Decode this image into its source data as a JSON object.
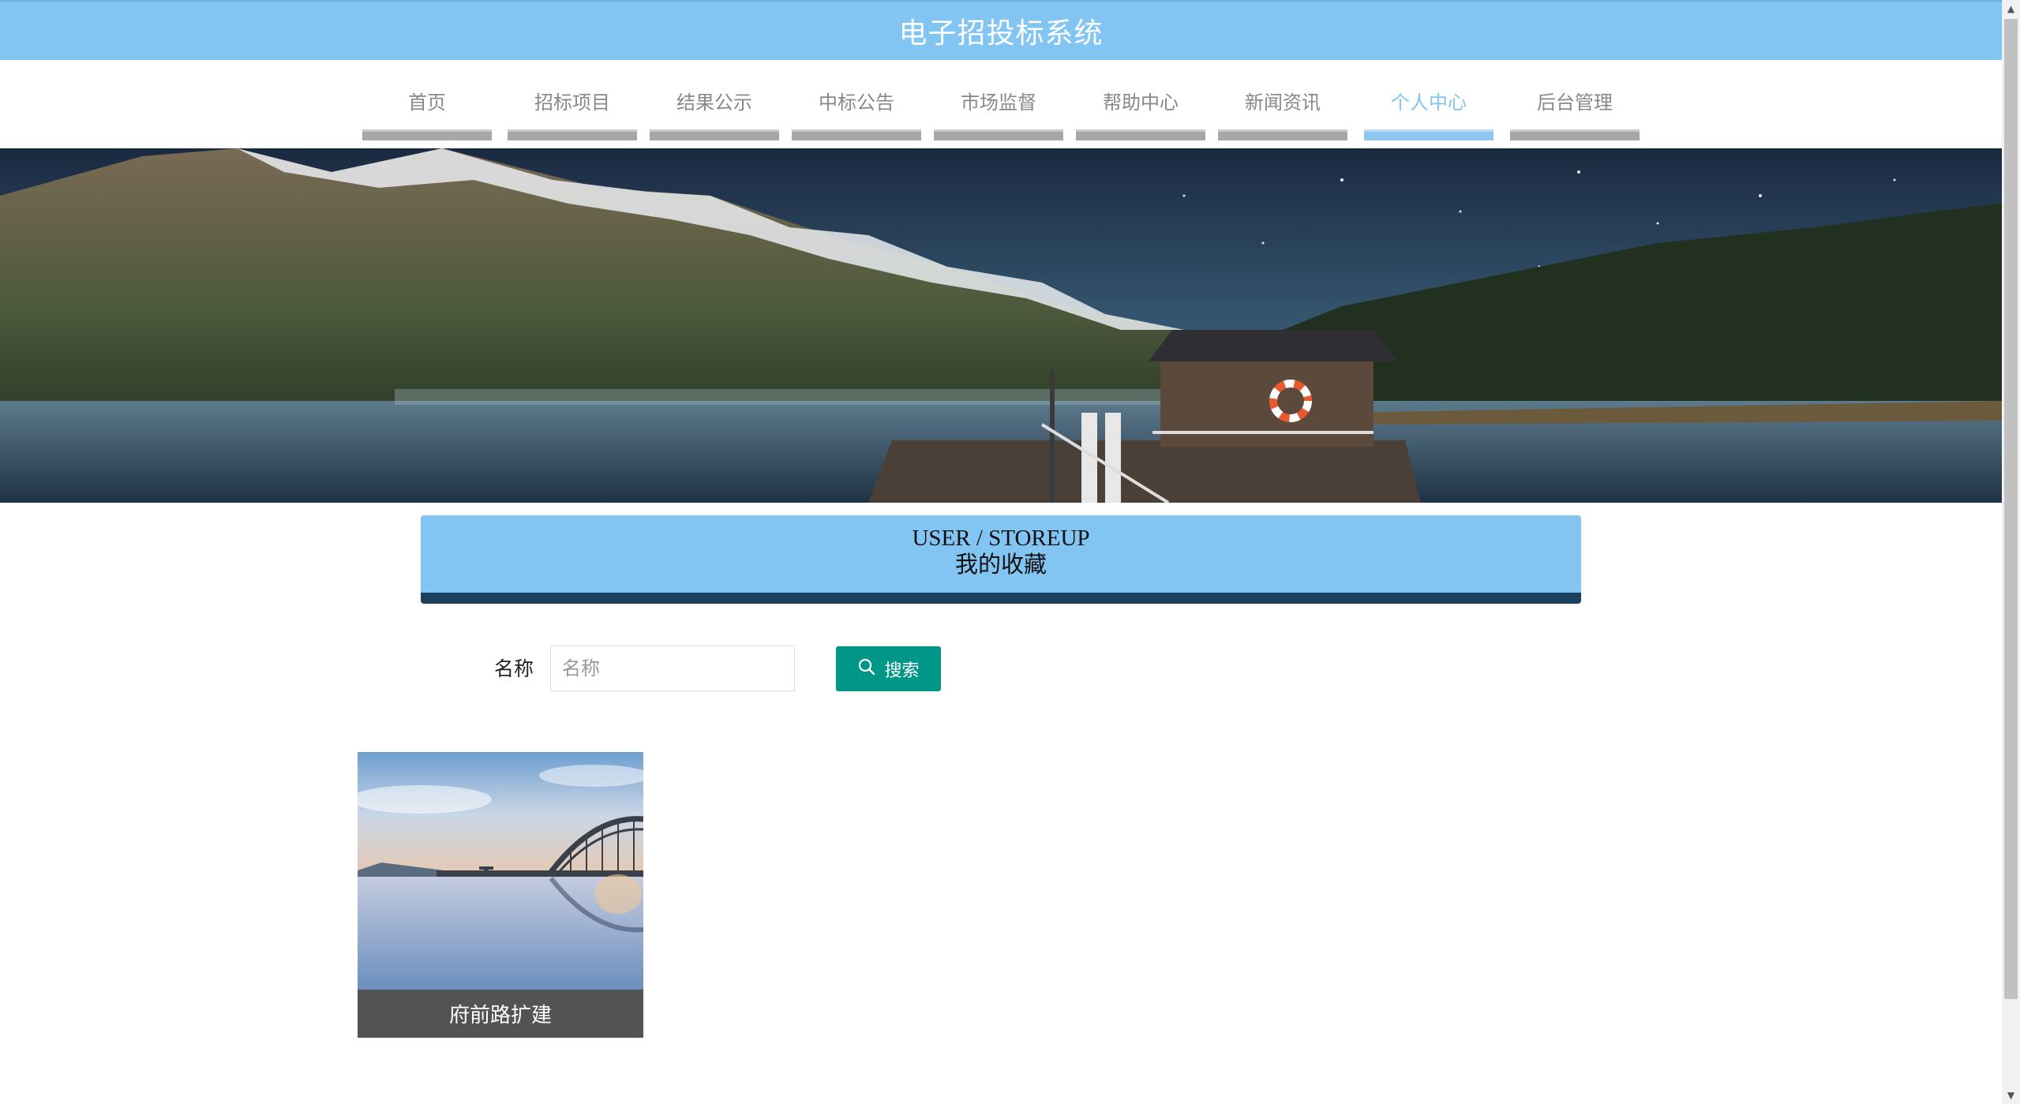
{
  "header": {
    "title": "电子招投标系统"
  },
  "nav": {
    "items": [
      {
        "label": "首页"
      },
      {
        "label": "招标项目"
      },
      {
        "label": "结果公示"
      },
      {
        "label": "中标公告"
      },
      {
        "label": "市场监督"
      },
      {
        "label": "帮助中心"
      },
      {
        "label": "新闻资讯"
      },
      {
        "label": "个人中心"
      },
      {
        "label": "后台管理"
      }
    ],
    "active": "个人中心"
  },
  "section": {
    "title_en": "USER / STOREUP",
    "title_cn": "我的收藏"
  },
  "search": {
    "label": "名称",
    "placeholder": "名称",
    "value": "",
    "button_label": "搜索"
  },
  "cards": [
    {
      "title": "府前路扩建"
    }
  ],
  "colors": {
    "primary": "#82c4f2",
    "section_border": "#1b3f5e",
    "search_button": "#009688",
    "card_caption_bg": "#535353",
    "nav_bar": "#a7a7a7"
  }
}
